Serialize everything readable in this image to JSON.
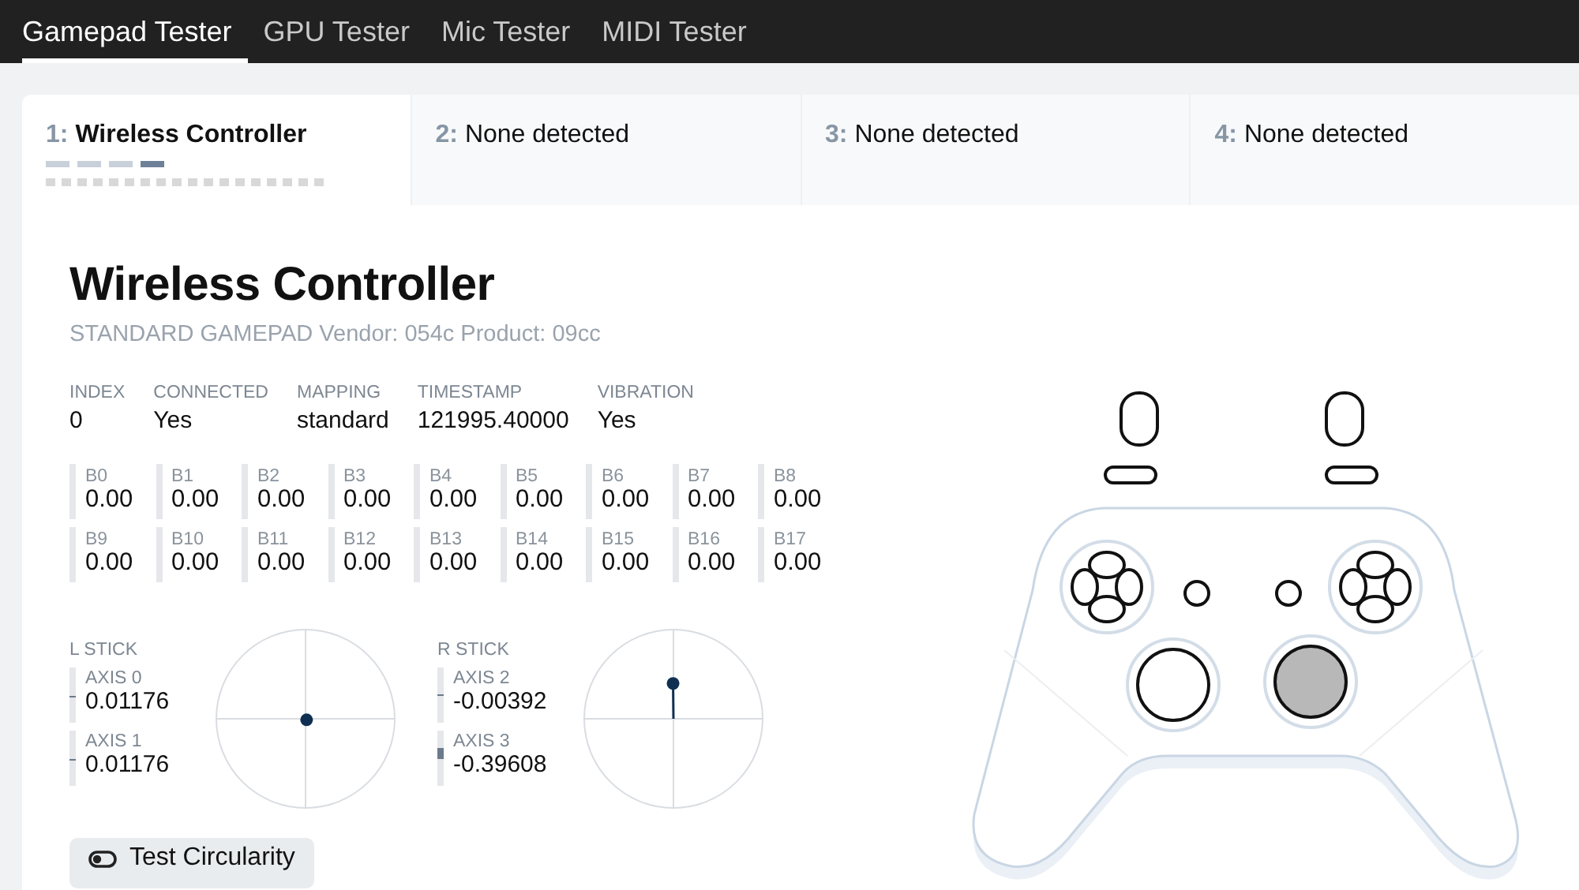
{
  "nav": [
    {
      "label": "Gamepad Tester",
      "selected": true
    },
    {
      "label": "GPU Tester",
      "selected": false
    },
    {
      "label": "Mic Tester",
      "selected": false
    },
    {
      "label": "MIDI Tester",
      "selected": false
    }
  ],
  "slots": [
    {
      "number": "1:",
      "name": "Wireless Controller",
      "selected": true
    },
    {
      "number": "2:",
      "name": "None detected",
      "selected": false
    },
    {
      "number": "3:",
      "name": "None detected",
      "selected": false
    },
    {
      "number": "4:",
      "name": "None detected",
      "selected": false
    }
  ],
  "gamepad": {
    "title": "Wireless Controller",
    "subtitle": "STANDARD GAMEPAD Vendor: 054c Product: 09cc",
    "info": [
      {
        "label": "INDEX",
        "value": "0"
      },
      {
        "label": "CONNECTED",
        "value": "Yes"
      },
      {
        "label": "MAPPING",
        "value": "standard"
      },
      {
        "label": "TIMESTAMP",
        "value": "121995.40000"
      },
      {
        "label": "VIBRATION",
        "value": "Yes"
      }
    ],
    "buttons": [
      {
        "label": "B0",
        "value": "0.00",
        "level": 0
      },
      {
        "label": "B1",
        "value": "0.00",
        "level": 0
      },
      {
        "label": "B2",
        "value": "0.00",
        "level": 0
      },
      {
        "label": "B3",
        "value": "0.00",
        "level": 0
      },
      {
        "label": "B4",
        "value": "0.00",
        "level": 0
      },
      {
        "label": "B5",
        "value": "0.00",
        "level": 0
      },
      {
        "label": "B6",
        "value": "0.00",
        "level": 0
      },
      {
        "label": "B7",
        "value": "0.00",
        "level": 0
      },
      {
        "label": "B8",
        "value": "0.00",
        "level": 0
      },
      {
        "label": "B9",
        "value": "0.00",
        "level": 0
      },
      {
        "label": "B10",
        "value": "0.00",
        "level": 0
      },
      {
        "label": "B11",
        "value": "0.00",
        "level": 0
      },
      {
        "label": "B12",
        "value": "0.00",
        "level": 0
      },
      {
        "label": "B13",
        "value": "0.00",
        "level": 0
      },
      {
        "label": "B14",
        "value": "0.00",
        "level": 0
      },
      {
        "label": "B15",
        "value": "0.00",
        "level": 0
      },
      {
        "label": "B16",
        "value": "0.00",
        "level": 0
      },
      {
        "label": "B17",
        "value": "0.00",
        "level": 0
      }
    ],
    "sticks": [
      {
        "label": "L STICK",
        "axes": [
          {
            "label": "AXIS 0",
            "value": "0.01176",
            "level": 0.506
          },
          {
            "label": "AXIS 1",
            "value": "0.01176",
            "level": 0.506
          }
        ]
      },
      {
        "label": "R STICK",
        "axes": [
          {
            "label": "AXIS 2",
            "value": "-0.00392",
            "level": 0.498
          },
          {
            "label": "AXIS 3",
            "value": "-0.39608",
            "level": 0.302
          }
        ]
      }
    ],
    "circularity_button": "Test Circularity"
  }
}
